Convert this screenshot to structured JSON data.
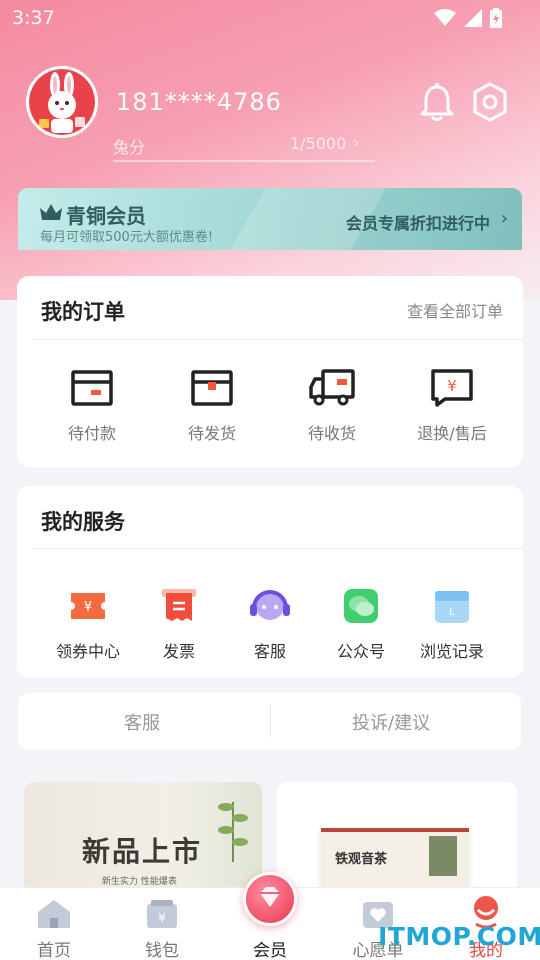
{
  "status_bar": {
    "time": "3:37"
  },
  "profile": {
    "phone": "181****4786",
    "points_label": "兔分",
    "points_value": "1/5000"
  },
  "membership": {
    "title": "青铜会员",
    "subtitle": "每月可领取500元大额优惠卷!",
    "promo": "会员专属折扣进行中"
  },
  "orders": {
    "title": "我的订单",
    "view_all": "查看全部订单",
    "items": [
      {
        "label": "待付款",
        "icon": "wallet-card-icon"
      },
      {
        "label": "待发货",
        "icon": "package-box-icon"
      },
      {
        "label": "待收货",
        "icon": "delivery-truck-icon"
      },
      {
        "label": "退换/售后",
        "icon": "refund-icon"
      }
    ]
  },
  "services": {
    "title": "我的服务",
    "items": [
      {
        "label": "领券中心",
        "icon": "coupon-icon"
      },
      {
        "label": "发票",
        "icon": "invoice-icon"
      },
      {
        "label": "客服",
        "icon": "headset-icon"
      },
      {
        "label": "公众号",
        "icon": "wechat-icon"
      },
      {
        "label": "浏览记录",
        "icon": "history-box-icon"
      }
    ]
  },
  "support_bar": {
    "left": "客服",
    "right": "投诉/建议"
  },
  "products": [
    {
      "title": "新品上市",
      "subtitle": "新生实力 性能爆表"
    },
    {
      "title": "铁观音茶"
    }
  ],
  "tabbar": {
    "items": [
      {
        "label": "首页",
        "icon": "home-icon"
      },
      {
        "label": "钱包",
        "icon": "wallet-icon"
      },
      {
        "label": "会员",
        "icon": "member-gem-icon"
      },
      {
        "label": "心愿单",
        "icon": "wishlist-icon"
      },
      {
        "label": "我的",
        "icon": "user-icon"
      }
    ],
    "active": "我的"
  },
  "watermark": "ITMOP.COM",
  "colors": {
    "accent": "#e24a43",
    "member_text": "#2f5d60",
    "hero_pink": "#f48aa0",
    "watermark": "#20a7d8"
  }
}
